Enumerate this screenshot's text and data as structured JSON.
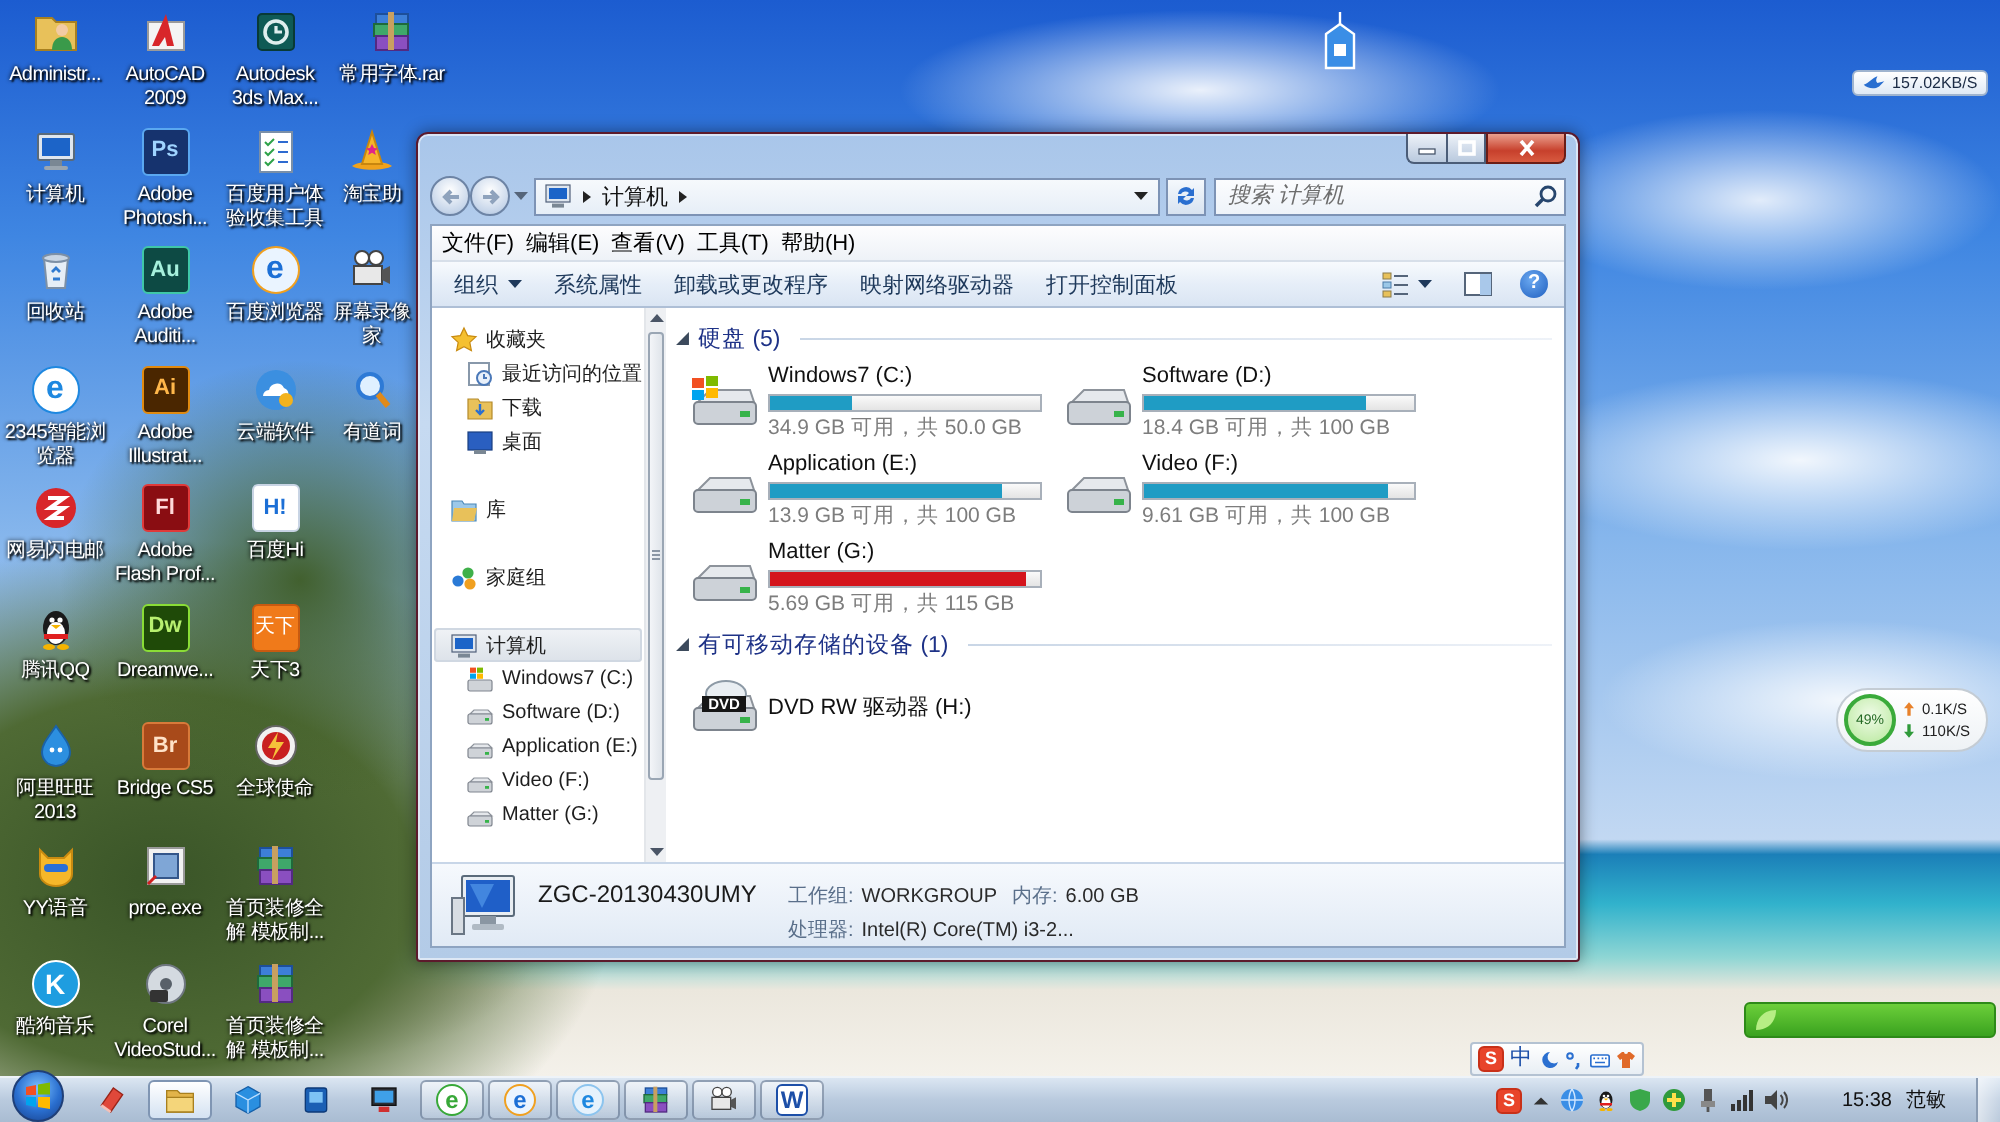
{
  "desktop": {
    "icons": [
      {
        "label": "Administr...",
        "kind": "user-folder"
      },
      {
        "label": "计算机",
        "kind": "computer"
      },
      {
        "label": "回收站",
        "kind": "recycle-bin"
      },
      {
        "label": "2345智能浏览器",
        "kind": "e-circle",
        "glyph": "e"
      },
      {
        "label": "网易闪电邮",
        "kind": "mail-swirl"
      },
      {
        "label": "腾讯QQ",
        "kind": "penguin"
      },
      {
        "label": "阿里旺旺2013",
        "kind": "drop-face"
      },
      {
        "label": "YY语音",
        "kind": "cat-face"
      },
      {
        "label": "酷狗音乐",
        "kind": "k-circle",
        "glyph": "K"
      },
      {
        "label": "AutoCAD 2009",
        "kind": "red-a"
      },
      {
        "label": "Adobe Photosh...",
        "kind": "ps",
        "glyph": "Ps"
      },
      {
        "label": "Adobe Auditi...",
        "kind": "au",
        "glyph": "Au"
      },
      {
        "label": "Adobe Illustrat...",
        "kind": "ai",
        "glyph": "Ai"
      },
      {
        "label": "Adobe Flash Prof...",
        "kind": "fl",
        "glyph": "Fl"
      },
      {
        "label": "Dreamwe...",
        "kind": "dw",
        "glyph": "Dw"
      },
      {
        "label": "Bridge CS5",
        "kind": "br",
        "glyph": "Br"
      },
      {
        "label": "proe.exe",
        "kind": "window-square"
      },
      {
        "label": "Corel VideoStud...",
        "kind": "film-reel"
      },
      {
        "label": "Autodesk 3ds Max...",
        "kind": "teal-swirl"
      },
      {
        "label": "百度用户体验收集工具",
        "kind": "checklist"
      },
      {
        "label": "百度浏览器",
        "kind": "e-ring",
        "glyph": "e"
      },
      {
        "label": "云端软件",
        "kind": "cloud"
      },
      {
        "label": "百度Hi",
        "kind": "h-bubble",
        "glyph": "H!"
      },
      {
        "label": "天下3",
        "kind": "tx-tile",
        "glyph": "天下"
      },
      {
        "label": "全球使命",
        "kind": "emblem"
      },
      {
        "label": "首页装修全解 模板制...",
        "kind": "archive"
      },
      {
        "label": "首页装修全解 模板制...",
        "kind": "archive"
      },
      {
        "label": "常用字体.rar",
        "kind": "archive"
      },
      {
        "label": "淘宝助",
        "kind": "wizard-hat"
      },
      {
        "label": "屏幕录像家",
        "kind": "film-camera"
      },
      {
        "label": "有道词",
        "kind": "magnifier"
      }
    ]
  },
  "widgets": {
    "net_speed": "157.02KB/S",
    "monitor": {
      "percent": "49%",
      "up": "0.1K/S",
      "down": "110K/S"
    },
    "ime": {
      "logo": "S",
      "mode": "中"
    }
  },
  "explorer": {
    "address": {
      "crumbs": [
        "计算机"
      ]
    },
    "search": {
      "placeholder": "搜索 计算机"
    },
    "menu": [
      "文件(F)",
      "编辑(E)",
      "查看(V)",
      "工具(T)",
      "帮助(H)"
    ],
    "toolbar": [
      {
        "label": "组织",
        "has_menu": true
      },
      {
        "label": "系统属性",
        "has_menu": false
      },
      {
        "label": "卸载或更改程序",
        "has_menu": false
      },
      {
        "label": "映射网络驱动器",
        "has_menu": false
      },
      {
        "label": "打开控制面板",
        "has_menu": false
      }
    ],
    "help": "?",
    "nav": [
      {
        "label": "收藏夹",
        "kind": "favorites",
        "selected": false,
        "children": [
          {
            "label": "最近访问的位置",
            "kind": "recent",
            "selected": false
          },
          {
            "label": "下载",
            "kind": "downloads",
            "selected": false
          },
          {
            "label": "桌面",
            "kind": "desktop",
            "selected": false
          }
        ]
      },
      {
        "label": "库",
        "kind": "library",
        "selected": false
      },
      {
        "label": "家庭组",
        "kind": "homegroup",
        "selected": false
      },
      {
        "label": "计算机",
        "kind": "computer",
        "selected": true,
        "children": [
          {
            "label": "Windows7 (C:)",
            "kind": "system-drive",
            "selected": false
          },
          {
            "label": "Software (D:)",
            "kind": "drive",
            "selected": false
          },
          {
            "label": "Application (E:)",
            "kind": "drive",
            "selected": false
          },
          {
            "label": "Video (F:)",
            "kind": "drive",
            "selected": false
          },
          {
            "label": "Matter (G:)",
            "kind": "drive",
            "selected": false
          }
        ]
      }
    ],
    "groups": [
      {
        "title": "硬盘 (5)",
        "expanded": true,
        "drives": [
          {
            "name": "Windows7 (C:)",
            "kind": "system",
            "level": 0.3,
            "free": "34.9 GB 可用，共 50.0 GB",
            "color": "#1f9cc4"
          },
          {
            "name": "Software (D:)",
            "kind": "disk",
            "level": 0.82,
            "free": "18.4 GB 可用，共 100 GB",
            "color": "#1f9cc4"
          },
          {
            "name": "Application (E:)",
            "kind": "disk",
            "level": 0.86,
            "free": "13.9 GB 可用，共 100 GB",
            "color": "#1f9cc4"
          },
          {
            "name": "Video (F:)",
            "kind": "disk",
            "level": 0.9,
            "free": "9.61 GB 可用，共 100 GB",
            "color": "#1f9cc4"
          },
          {
            "name": "Matter (G:)",
            "kind": "disk",
            "level": 0.95,
            "free": "5.69 GB 可用，共 115 GB",
            "color": "#d4141c"
          }
        ]
      },
      {
        "title": "有可移动存储的设备 (1)",
        "expanded": true,
        "drives": [
          {
            "name": "DVD RW 驱动器 (H:)",
            "kind": "dvd",
            "glyph": "DVD"
          }
        ]
      }
    ],
    "details": {
      "name": "ZGC-20130430UMY",
      "fields": [
        {
          "label": "工作组:",
          "value": "WORKGROUP"
        },
        {
          "label": "内存:",
          "value": "6.00 GB"
        },
        {
          "label": "处理器:",
          "value": "Intel(R) Core(TM) i3-2..."
        }
      ]
    }
  },
  "taskbar": {
    "apps": [
      {
        "kind": "paint",
        "running": false,
        "selected": false
      },
      {
        "kind": "explorer",
        "running": true,
        "selected": true
      },
      {
        "kind": "cube",
        "running": false,
        "selected": false
      },
      {
        "kind": "blue-app",
        "running": false,
        "selected": false
      },
      {
        "kind": "monitor",
        "running": false,
        "selected": false
      },
      {
        "kind": "e-green",
        "glyph": "e",
        "running": true,
        "selected": false
      },
      {
        "kind": "e-ring",
        "glyph": "e",
        "running": true,
        "selected": false
      },
      {
        "kind": "e-blue",
        "glyph": "e",
        "running": true,
        "selected": false
      },
      {
        "kind": "archive",
        "running": true,
        "selected": false
      },
      {
        "kind": "film-camera",
        "running": true,
        "selected": false
      },
      {
        "kind": "w-doc",
        "glyph": "W",
        "running": true,
        "selected": false
      }
    ],
    "tray": {
      "ime_logo": "S",
      "clock": "15:38",
      "user": "范敏"
    }
  }
}
